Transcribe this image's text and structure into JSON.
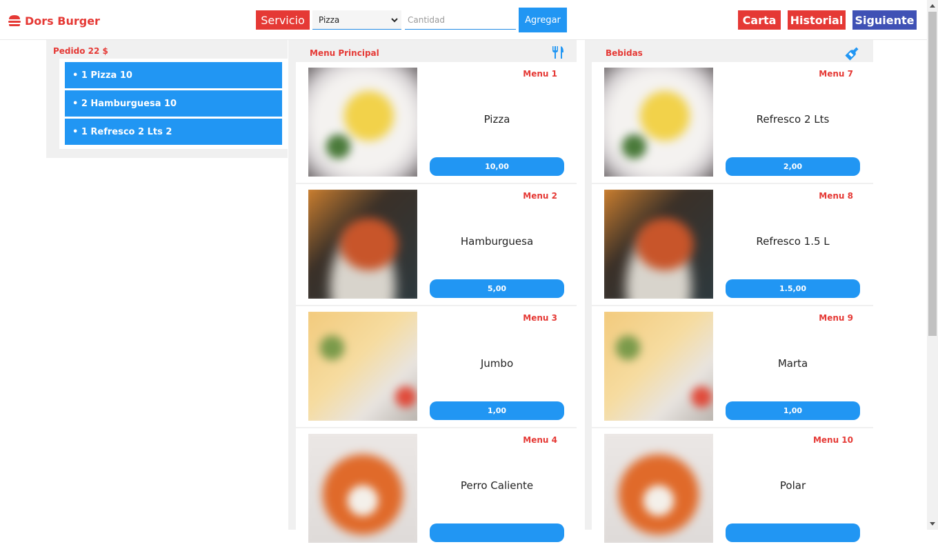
{
  "header": {
    "brand": "Dors Burger",
    "servicio_label": "Servicio",
    "select_value": "Pizza",
    "cantidad_placeholder": "Cantidad",
    "agregar_label": "Agregar",
    "carta_label": "Carta",
    "historial_label": "Historial",
    "siguiente_label": "Siguiente"
  },
  "order": {
    "title": "Pedido 22 $",
    "items": [
      "• 1 Pizza 10",
      "• 2 Hamburguesa 10",
      "• 1 Refresco 2 Lts 2"
    ]
  },
  "menu_principal": {
    "title": "Menu Principal",
    "icon": "fork-knife-icon",
    "items": [
      {
        "label": "Menu 1",
        "name": "Pizza",
        "price": "10,00"
      },
      {
        "label": "Menu 2",
        "name": "Hamburguesa",
        "price": "5,00"
      },
      {
        "label": "Menu 3",
        "name": "Jumbo",
        "price": "1,00"
      },
      {
        "label": "Menu 4",
        "name": "Perro Caliente",
        "price": ""
      }
    ]
  },
  "bebidas": {
    "title": "Bebidas",
    "icon": "bottle-icon",
    "items": [
      {
        "label": "Menu 7",
        "name": "Refresco 2 Lts",
        "price": "2,00"
      },
      {
        "label": "Menu 8",
        "name": "Refresco 1.5 L",
        "price": "1.5,00"
      },
      {
        "label": "Menu 9",
        "name": "Marta",
        "price": "1,00"
      },
      {
        "label": "Menu 10",
        "name": "Polar",
        "price": ""
      }
    ]
  },
  "colors": {
    "red": "#e53935",
    "blue": "#2196f3",
    "indigo": "#3f51b5",
    "panel_bg": "#f0f0f0"
  }
}
